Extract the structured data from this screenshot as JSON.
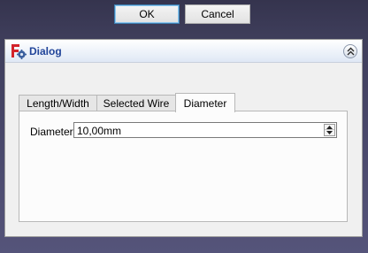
{
  "buttons": {
    "ok": "OK",
    "cancel": "Cancel"
  },
  "panel": {
    "title": "Dialog",
    "icons": {
      "app": "freecad-gear-icon",
      "collapse": "double-chevron-up-icon"
    }
  },
  "tabs": [
    {
      "label": "Length/Width",
      "active": false
    },
    {
      "label": "Selected Wire",
      "active": false
    },
    {
      "label": "Diameter",
      "active": true
    }
  ],
  "diameter_field": {
    "label": "Diameter",
    "value": "10,00mm",
    "icons": {
      "up": "spin-up-icon",
      "down": "spin-down-icon"
    }
  },
  "colors": {
    "title_text": "#21459a",
    "default_button_border": "#3c7fb1"
  }
}
